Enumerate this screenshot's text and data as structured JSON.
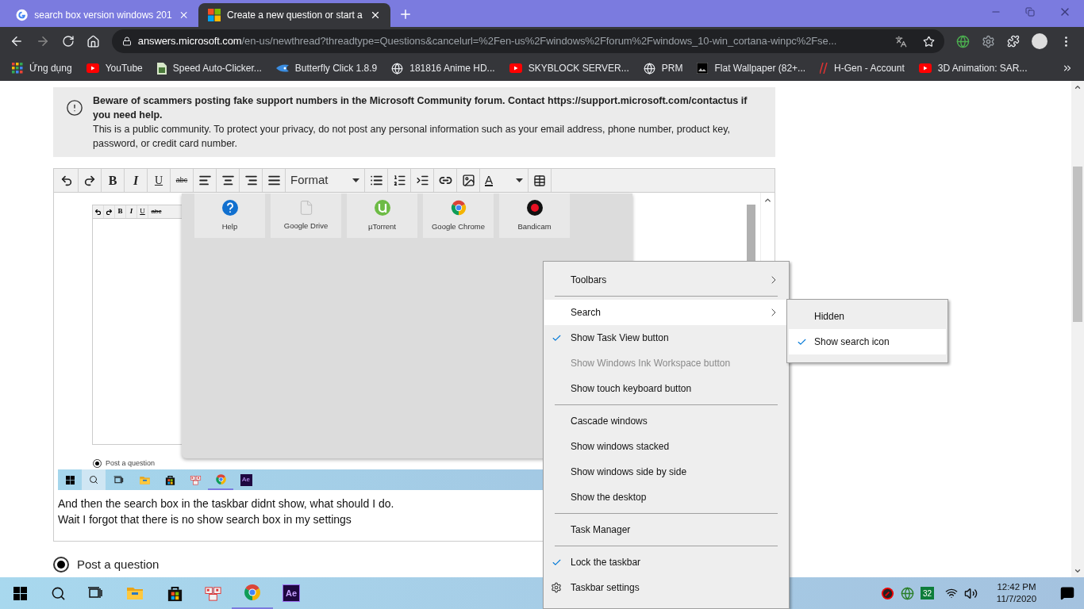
{
  "browser": {
    "tabs": [
      {
        "title": "search box version windows 201",
        "selected": false,
        "kind": "google"
      },
      {
        "title": "Create a new question or start a",
        "selected": true,
        "kind": "microsoft"
      }
    ],
    "address": {
      "domain": "answers.microsoft.com",
      "path": "/en-us/newthread?threadtype=Questions&cancelurl=%2Fen-us%2Fwindows%2Fforum%2Fwindows_10-win_cortana-winpc%2Fse..."
    },
    "bookmarks": [
      {
        "label": "Ứng dụng",
        "kind": "apps"
      },
      {
        "label": "YouTube",
        "kind": "youtube"
      },
      {
        "label": "Speed Auto-Clicker...",
        "kind": "file"
      },
      {
        "label": "Butterfly Click 1.8.9",
        "kind": "bird"
      },
      {
        "label": "181816 Anime HD...",
        "kind": "globe"
      },
      {
        "label": "SKYBLOCK SERVER...",
        "kind": "youtube"
      },
      {
        "label": "PRM",
        "kind": "globe"
      },
      {
        "label": "Flat Wallpaper (82+...",
        "kind": "image"
      },
      {
        "label": "H-Gen - Account",
        "kind": "slash"
      },
      {
        "label": "3D Animation: SAR...",
        "kind": "youtube"
      }
    ]
  },
  "notice": {
    "warning": "Beware of scammers posting fake support numbers in the Microsoft Community forum. Contact https://support.microsoft.com/contactus if you need help.",
    "info": "This is a public community. To protect your privacy, do not post any personal information such as your email address, phone number, product key, password, or credit card number."
  },
  "editor": {
    "toolbar": {
      "bold": "B",
      "italic": "I",
      "underline": "U",
      "strike": "abc",
      "format": "Format",
      "font_color_label": "A"
    },
    "pasted_screenshot": {
      "toolbar": {
        "bold": "B",
        "italic": "I",
        "underline": "U",
        "strike": "abc"
      },
      "tiles": [
        {
          "label": "Help",
          "kind": "help"
        },
        {
          "label": "Google Drive",
          "kind": "file"
        },
        {
          "label": "µTorrent",
          "kind": "torrent"
        },
        {
          "label": "Google Chrome",
          "kind": "chrome"
        },
        {
          "label": "Bandicam",
          "kind": "record"
        }
      ],
      "option": {
        "label": "Post a question",
        "selected": true
      },
      "taskbar": {
        "app_label": "Ae"
      }
    },
    "lines": [
      "And then the search box in the taskbar didnt show, what should I do.",
      "Wait I forgot that there is no show search box in my settings"
    ]
  },
  "post_option": {
    "label": "Post a question",
    "selected": true
  },
  "context_menu": {
    "items": [
      {
        "kind": "item",
        "label": "Toolbars",
        "checked": false,
        "disabled": false,
        "selected": false,
        "submenu": true
      },
      {
        "kind": "separator"
      },
      {
        "kind": "item",
        "label": "Search",
        "checked": false,
        "disabled": false,
        "selected": true,
        "submenu": true
      },
      {
        "kind": "item",
        "label": "Show Task View button",
        "checked": true,
        "disabled": false,
        "selected": false,
        "submenu": false
      },
      {
        "kind": "item",
        "label": "Show Windows Ink Workspace button",
        "checked": false,
        "disabled": true,
        "selected": false,
        "submenu": false
      },
      {
        "kind": "item",
        "label": "Show touch keyboard button",
        "checked": false,
        "disabled": false,
        "selected": false,
        "submenu": false
      },
      {
        "kind": "separator"
      },
      {
        "kind": "item",
        "label": "Cascade windows",
        "checked": false,
        "disabled": false,
        "selected": false,
        "submenu": false
      },
      {
        "kind": "item",
        "label": "Show windows stacked",
        "checked": false,
        "disabled": false,
        "selected": false,
        "submenu": false
      },
      {
        "kind": "item",
        "label": "Show windows side by side",
        "checked": false,
        "disabled": false,
        "selected": false,
        "submenu": false
      },
      {
        "kind": "item",
        "label": "Show the desktop",
        "checked": false,
        "disabled": false,
        "selected": false,
        "submenu": false
      },
      {
        "kind": "separator"
      },
      {
        "kind": "item",
        "label": "Task Manager",
        "checked": false,
        "disabled": false,
        "selected": false,
        "submenu": false
      },
      {
        "kind": "separator"
      },
      {
        "kind": "item",
        "label": "Lock the taskbar",
        "checked": true,
        "disabled": false,
        "selected": false,
        "submenu": false
      },
      {
        "kind": "setting",
        "label": "Taskbar settings",
        "checked": false,
        "disabled": false,
        "selected": false,
        "submenu": false
      }
    ]
  },
  "submenu": {
    "items": [
      {
        "label": "Hidden",
        "checked": false,
        "selected": false
      },
      {
        "label": "Show search icon",
        "checked": true,
        "selected": true
      }
    ]
  },
  "taskbar": {
    "app_label": "Ae",
    "tray_badge": "32",
    "time": "12:42 PM",
    "date": "11/7/2020"
  }
}
